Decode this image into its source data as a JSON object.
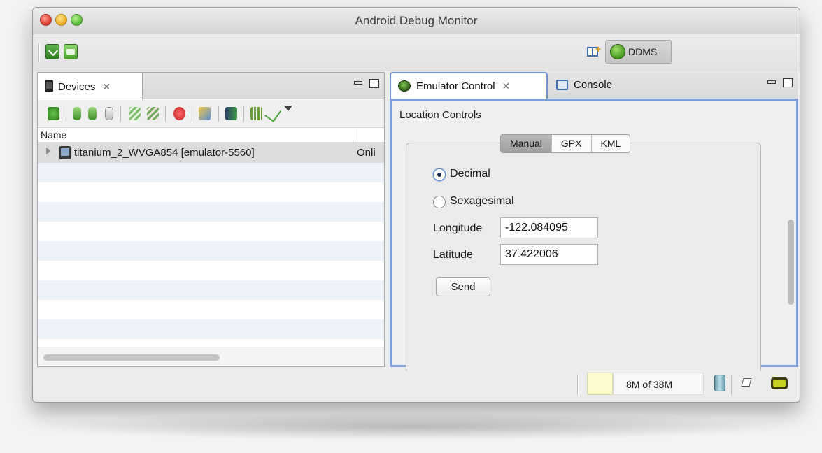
{
  "window": {
    "title": "Android Debug Monitor"
  },
  "toolbar": {
    "perspective_button": "DDMS"
  },
  "devices_view": {
    "tab_label": "Devices",
    "column_name": "Name",
    "rows": [
      {
        "name": "titanium_2_WVGA854 [emulator-5560]",
        "status": "Onli"
      }
    ]
  },
  "emulator_view": {
    "tab_label": "Emulator Control",
    "console_tab_label": "Console",
    "section_title": "Location Controls",
    "modes": [
      "Manual",
      "GPX",
      "KML"
    ],
    "selected_mode": "Manual",
    "format_options": [
      "Decimal",
      "Sexagesimal"
    ],
    "selected_format": "Decimal",
    "longitude_label": "Longitude",
    "longitude_value": "-122.084095",
    "latitude_label": "Latitude",
    "latitude_value": "37.422006",
    "send_label": "Send"
  },
  "status_bar": {
    "heap": "8M of 38M"
  },
  "colors": {
    "active_view_border": "#7ea0d6",
    "heap_indicator": "#fbfbcb"
  }
}
